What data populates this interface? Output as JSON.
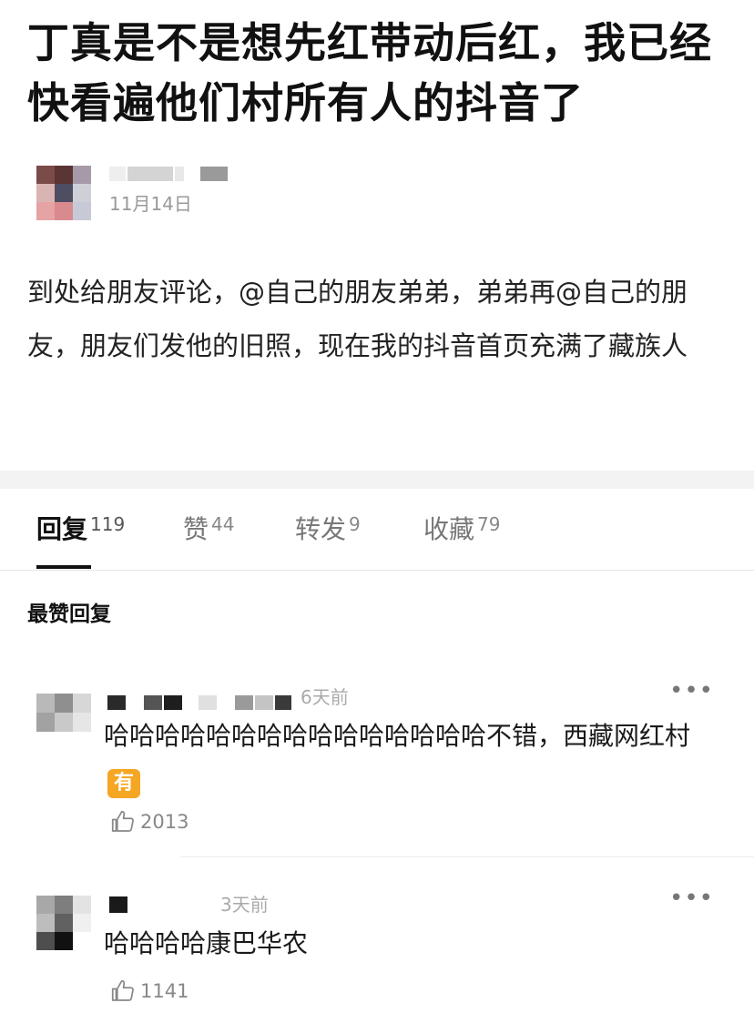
{
  "post": {
    "title": "丁真是不是想先红带动后红，我已经快看遍他们村所有人的抖音了",
    "date": "11月14日",
    "body": "到处给朋友评论，@自己的朋友弟弟，弟弟再@自己的朋友，朋友们发他的旧照，现在我的抖音首页充满了藏族人"
  },
  "tabs": [
    {
      "label": "回复",
      "count": "119"
    },
    {
      "label": "赞",
      "count": "44"
    },
    {
      "label": "转发",
      "count": "9"
    },
    {
      "label": "收藏",
      "count": "79"
    }
  ],
  "section_title": "最赞回复",
  "comments": [
    {
      "time": "6天前",
      "text": "哈哈哈哈哈哈哈哈哈哈哈哈哈哈哈不错，西藏网红村",
      "badge": "有",
      "likes": "2013"
    },
    {
      "time": "3天前",
      "text": "哈哈哈哈康巴华农",
      "likes": "1141"
    }
  ],
  "icons": {
    "like": "thumbs-up-icon",
    "more": "more-dots-icon"
  },
  "colors": {
    "badge": "#f5a623",
    "divider_bar": "#f3f3f3"
  }
}
